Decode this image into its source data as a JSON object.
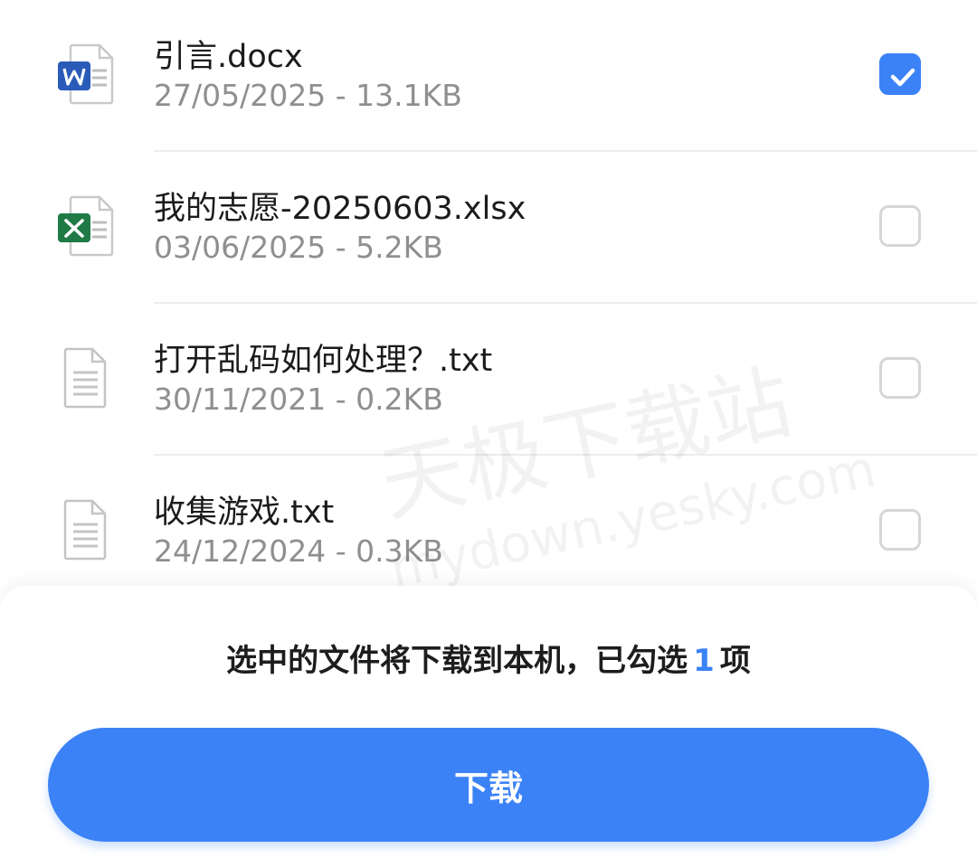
{
  "files": [
    {
      "name": "引言.docx",
      "meta": "27/05/2025 - 13.1KB",
      "icon": "word-doc-icon",
      "checked": true
    },
    {
      "name": "我的志愿-20250603.xlsx",
      "meta": "03/06/2025 - 5.2KB",
      "icon": "excel-sheet-icon",
      "checked": false
    },
    {
      "name": "打开乱码如何处理？.txt",
      "meta": "30/11/2021 - 0.2KB",
      "icon": "text-file-icon",
      "checked": false
    },
    {
      "name": "收集游戏.txt",
      "meta": "24/12/2024 - 0.3KB",
      "icon": "text-file-icon",
      "checked": false
    }
  ],
  "watermark": {
    "line1": "天极下载站",
    "line2": "mydown.yesky.com"
  },
  "footer": {
    "summary_prefix": "选中的文件将下载到本机，已勾选",
    "selected_count": "1",
    "summary_suffix": "项",
    "download_label": "下载"
  },
  "colors": {
    "accent": "#3b82f6",
    "word": "#2b5bb8",
    "excel": "#1f7a45"
  }
}
